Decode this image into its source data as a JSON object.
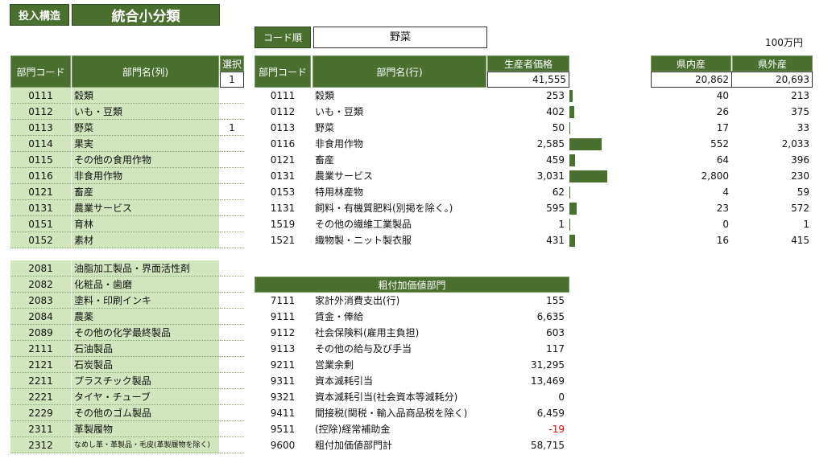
{
  "buttons": {
    "input_structure": "投入構造",
    "title": "統合小分類"
  },
  "sort": {
    "label": "コード順",
    "value": "野菜"
  },
  "unit": "100万円",
  "left_table": {
    "col_code": "部門コード",
    "col_name": "部門名(列)",
    "col_select": "選択",
    "select_total": "1",
    "rows": [
      {
        "code": "0111",
        "name": "穀類",
        "sel": ""
      },
      {
        "code": "0112",
        "name": "いも・豆類",
        "sel": ""
      },
      {
        "code": "0113",
        "name": "野菜",
        "sel": "1"
      },
      {
        "code": "0114",
        "name": "果実",
        "sel": ""
      },
      {
        "code": "0115",
        "name": "その他の食用作物",
        "sel": ""
      },
      {
        "code": "0116",
        "name": "非食用作物",
        "sel": ""
      },
      {
        "code": "0121",
        "name": "畜産",
        "sel": ""
      },
      {
        "code": "0131",
        "name": "農業サービス",
        "sel": ""
      },
      {
        "code": "0151",
        "name": "育林",
        "sel": ""
      },
      {
        "code": "0152",
        "name": "素材",
        "sel": ""
      }
    ],
    "rows2": [
      {
        "code": "2081",
        "name": "油脂加工製品・界面活性剤"
      },
      {
        "code": "2082",
        "name": "化粧品・歯磨"
      },
      {
        "code": "2083",
        "name": "塗料・印刷インキ"
      },
      {
        "code": "2084",
        "name": "農薬"
      },
      {
        "code": "2089",
        "name": "その他の化学最終製品"
      },
      {
        "code": "2111",
        "name": "石油製品"
      },
      {
        "code": "2121",
        "name": "石炭製品"
      },
      {
        "code": "2211",
        "name": "プラスチック製品"
      },
      {
        "code": "2221",
        "name": "タイヤ・チューブ"
      },
      {
        "code": "2229",
        "name": "その他のゴム製品"
      },
      {
        "code": "2311",
        "name": "革製履物"
      },
      {
        "code": "2312",
        "name": "なめし革・革製品・毛皮(革製履物を除く)"
      }
    ]
  },
  "mid_table": {
    "col_code": "部門コード",
    "col_name": "部門名(行)",
    "col_price": "生産者価格",
    "total": "41,555",
    "rows": [
      {
        "code": "0111",
        "name": "穀類",
        "value": "253",
        "amount": 253
      },
      {
        "code": "0112",
        "name": "いも・豆類",
        "value": "402",
        "amount": 402
      },
      {
        "code": "0113",
        "name": "野菜",
        "value": "50",
        "amount": 50
      },
      {
        "code": "0116",
        "name": "非食用作物",
        "value": "2,585",
        "amount": 2585
      },
      {
        "code": "0121",
        "name": "畜産",
        "value": "459",
        "amount": 459
      },
      {
        "code": "0131",
        "name": "農業サービス",
        "value": "3,031",
        "amount": 3031
      },
      {
        "code": "0153",
        "name": "特用林産物",
        "value": "62",
        "amount": 62
      },
      {
        "code": "1131",
        "name": "飼料・有機質肥料(別掲を除く。)",
        "value": "595",
        "amount": 595
      },
      {
        "code": "1519",
        "name": "その他の繊維工業製品",
        "value": "1",
        "amount": 1
      },
      {
        "code": "1521",
        "name": "織物製・ニット製衣服",
        "value": "431",
        "amount": 431
      }
    ]
  },
  "right_table": {
    "col_in": "県内産",
    "col_out": "県外産",
    "total_in": "20,862",
    "total_out": "20,693",
    "rows": [
      {
        "in": "40",
        "out": "213"
      },
      {
        "in": "26",
        "out": "375"
      },
      {
        "in": "17",
        "out": "33"
      },
      {
        "in": "552",
        "out": "2,033"
      },
      {
        "in": "64",
        "out": "396"
      },
      {
        "in": "2,800",
        "out": "230"
      },
      {
        "in": "4",
        "out": "59"
      },
      {
        "in": "23",
        "out": "572"
      },
      {
        "in": "0",
        "out": "1"
      },
      {
        "in": "16",
        "out": "415"
      }
    ]
  },
  "value_added": {
    "header": "粗付加価値部門",
    "rows": [
      {
        "code": "7111",
        "name": "家計外消費支出(行)",
        "value": "155",
        "negative": false
      },
      {
        "code": "9111",
        "name": "賃金・俸給",
        "value": "6,635",
        "negative": false
      },
      {
        "code": "9112",
        "name": "社会保険料(雇用主負担)",
        "value": "603",
        "negative": false
      },
      {
        "code": "9113",
        "name": "その他の給与及び手当",
        "value": "117",
        "negative": false
      },
      {
        "code": "9211",
        "name": "営業余剰",
        "value": "31,295",
        "negative": false
      },
      {
        "code": "9311",
        "name": "資本減耗引当",
        "value": "13,469",
        "negative": false
      },
      {
        "code": "9321",
        "name": "資本減耗引当(社会資本等減耗分)",
        "value": "0",
        "negative": false
      },
      {
        "code": "9411",
        "name": "間接税(関税・輸入品商品税を除く)",
        "value": "6,459",
        "negative": false
      },
      {
        "code": "9511",
        "name": "(控除)経常補助金",
        "value": "-19",
        "negative": true
      },
      {
        "code": "9600",
        "name": "粗付加価値部門計",
        "value": "58,715",
        "negative": false
      }
    ]
  }
}
